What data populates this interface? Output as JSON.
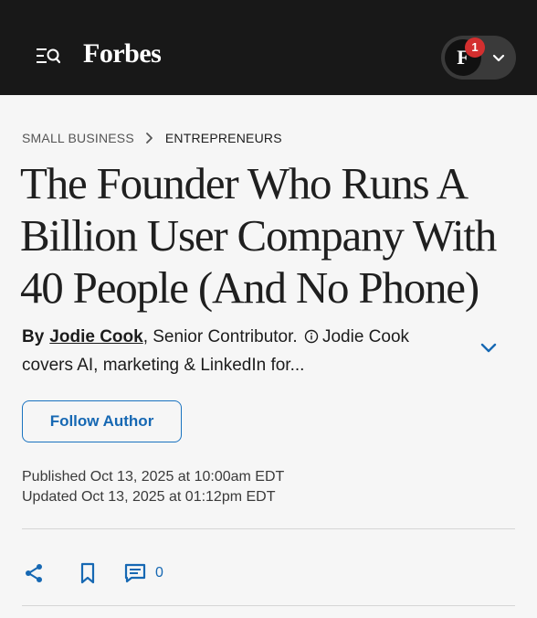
{
  "header": {
    "brand": "Forbes",
    "avatar_letter": "F",
    "notification_count": "1",
    "icons": [
      "menu-search-icon",
      "chevron-down-icon"
    ]
  },
  "breadcrumb": {
    "items": [
      "SMALL BUSINESS",
      "ENTREPRENEURS"
    ],
    "separator_icon": "chevron-right-icon"
  },
  "article": {
    "title_lines": [
      "The Founder Who Runs A",
      "Billion User Company With",
      "40 People (And No Phone)"
    ],
    "byline": {
      "by": "By",
      "author": "Jodie Cook",
      "role": ", Senior Contributor.",
      "bio": "Jodie Cook covers AI, marketing & LinkedIn for..."
    },
    "follow_label": "Follow Author",
    "published": "Published Oct 13, 2025 at 10:00am EDT",
    "updated": "Updated Oct 13, 2025 at 01:12pm EDT"
  },
  "actions": {
    "comment_count": "0",
    "icons": [
      "share-icon",
      "bookmark-icon",
      "comment-icon"
    ]
  },
  "colors": {
    "header_bg": "#181818",
    "accent": "#1668b3",
    "badge": "#d32f2f",
    "page_bg": "#f6f6f6"
  }
}
